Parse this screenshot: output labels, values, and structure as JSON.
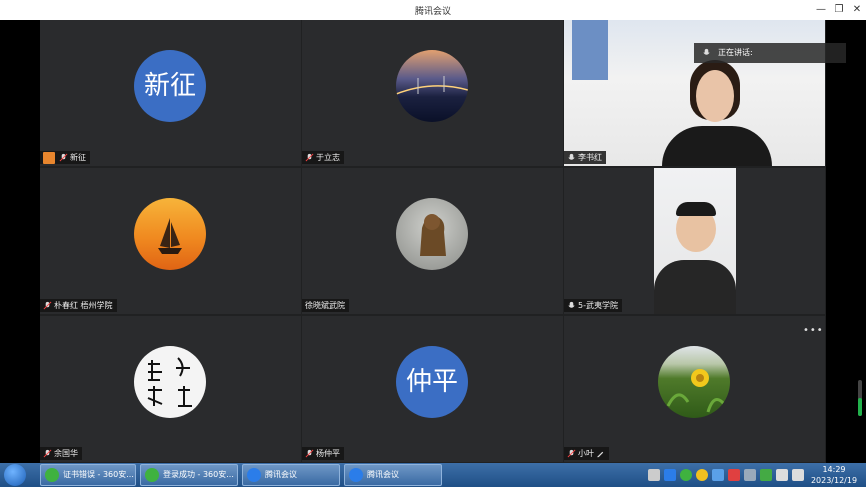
{
  "window": {
    "title": "腾讯会议"
  },
  "speaking": {
    "label": "正在讲话:"
  },
  "participants": [
    {
      "name": "新征",
      "avatar_text": "新征",
      "avatar_type": "text",
      "icon": "orange-host-icon"
    },
    {
      "name": "于立志",
      "avatar_type": "photo-bridge",
      "icon": "mic-muted-icon"
    },
    {
      "name": "李书红",
      "avatar_type": "video",
      "icon": "mic-icon"
    },
    {
      "name": "朴春红 梧州学院",
      "avatar_type": "photo-sailboat",
      "icon": "mic-muted-icon"
    },
    {
      "name": "徐晓斌武院",
      "avatar_type": "photo-lion-statue",
      "icon": ""
    },
    {
      "name": "5-武夷学院",
      "avatar_type": "video",
      "icon": "mic-icon"
    },
    {
      "name": "余国华",
      "avatar_type": "photo-calligraphy",
      "icon": "mic-muted-icon"
    },
    {
      "name": "杨仲平",
      "avatar_text": "仲平",
      "avatar_type": "text",
      "icon": "mic-muted-icon"
    },
    {
      "name": "小叶",
      "avatar_type": "photo-flower",
      "icon": "mic-muted-icon",
      "extra_icon": "pencil-icon"
    }
  ],
  "taskbar": {
    "items": [
      {
        "label": "证书错误 - 360安...",
        "icon": "360-browser-icon"
      },
      {
        "label": "登录成功 - 360安...",
        "icon": "360-browser-icon"
      },
      {
        "label": "腾讯会议",
        "icon": "tencent-meeting-icon"
      },
      {
        "label": "腾讯会议",
        "icon": "tencent-meeting-icon"
      }
    ],
    "clock_time": "14:29",
    "clock_date": "2023/12/19"
  },
  "colors": {
    "accent": "#3b6ec4",
    "tile_bg": "#2a2b2d",
    "host_icon": "#e8862e"
  }
}
